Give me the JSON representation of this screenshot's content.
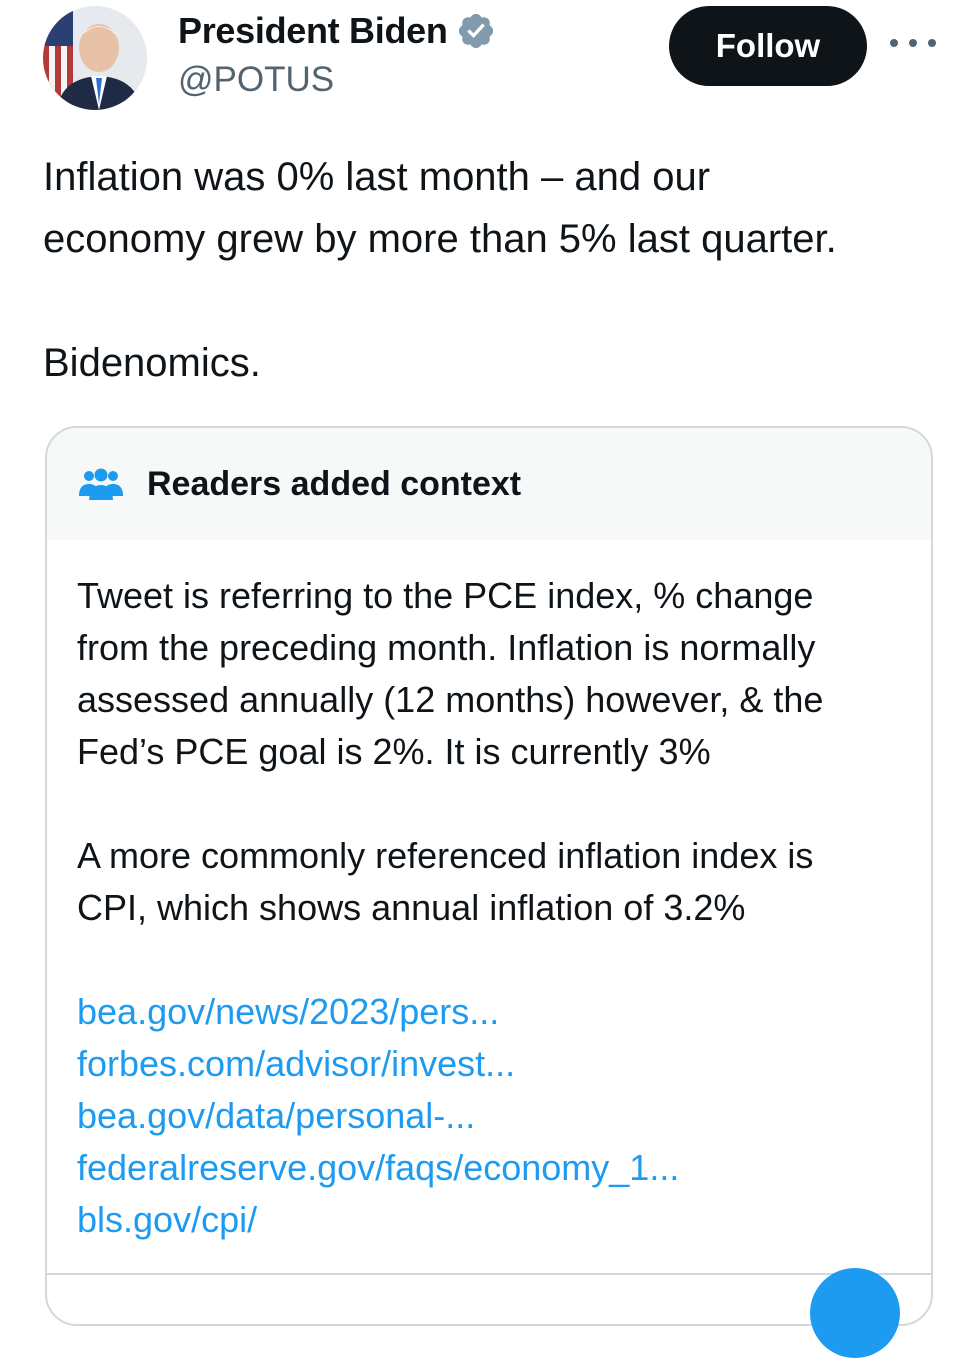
{
  "author": {
    "display_name": "President Biden",
    "handle": "@POTUS",
    "verified_icon": "verified-badge-icon",
    "avatar": "profile-photo"
  },
  "actions": {
    "follow_label": "Follow",
    "more_icon": "more-horizontal-icon"
  },
  "tweet": {
    "text": "Inflation was 0% last month – and our\neconomy grew by more than 5% last quarter.\n\nBidenomics."
  },
  "community_note": {
    "title": "Readers added context",
    "icon": "people-icon",
    "paragraphs": [
      "Tweet is referring to the PCE index, % change\nfrom the preceding month. Inflation is normally\nassessed annually (12 months) however, & the\nFed’s PCE goal is 2%. It is currently 3%",
      "A more commonly referenced inflation index is\nCPI, which shows annual inflation of 3.2%"
    ],
    "links": [
      "bea.gov/news/2023/pers...",
      "forbes.com/advisor/invest...",
      "bea.gov/data/personal-...",
      "federalreserve.gov/faqs/economy_1...",
      "bls.gov/cpi/"
    ]
  },
  "colors": {
    "text": "#0f1419",
    "secondary": "#536471",
    "link": "#1d9bf0",
    "verified": "#829aab",
    "people_icon": "#1d9bf0",
    "border": "#cfd9de",
    "header_bg": "#f7f9f9"
  }
}
